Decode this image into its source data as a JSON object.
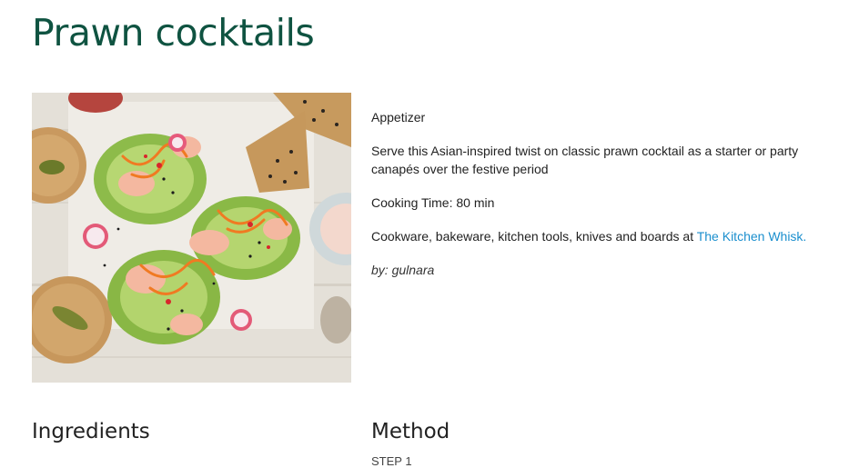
{
  "recipe": {
    "title": "Prawn cocktails",
    "image_alt": "Prawn cocktails in lettuce cups with crackers",
    "category": "Appetizer",
    "description": "Serve this Asian-inspired twist on classic prawn cocktail as a starter or party canapés over the festive period",
    "cooking_time": "Cooking Time: 80 min",
    "promo_text": "Cookware, bakeware, kitchen tools, knives and boards at ",
    "promo_link": "The Kitchen Whisk.",
    "author": "by: gulnara"
  },
  "sections": {
    "ingredients": "Ingredients",
    "method": "Method",
    "method_first_line": "STEP 1"
  }
}
